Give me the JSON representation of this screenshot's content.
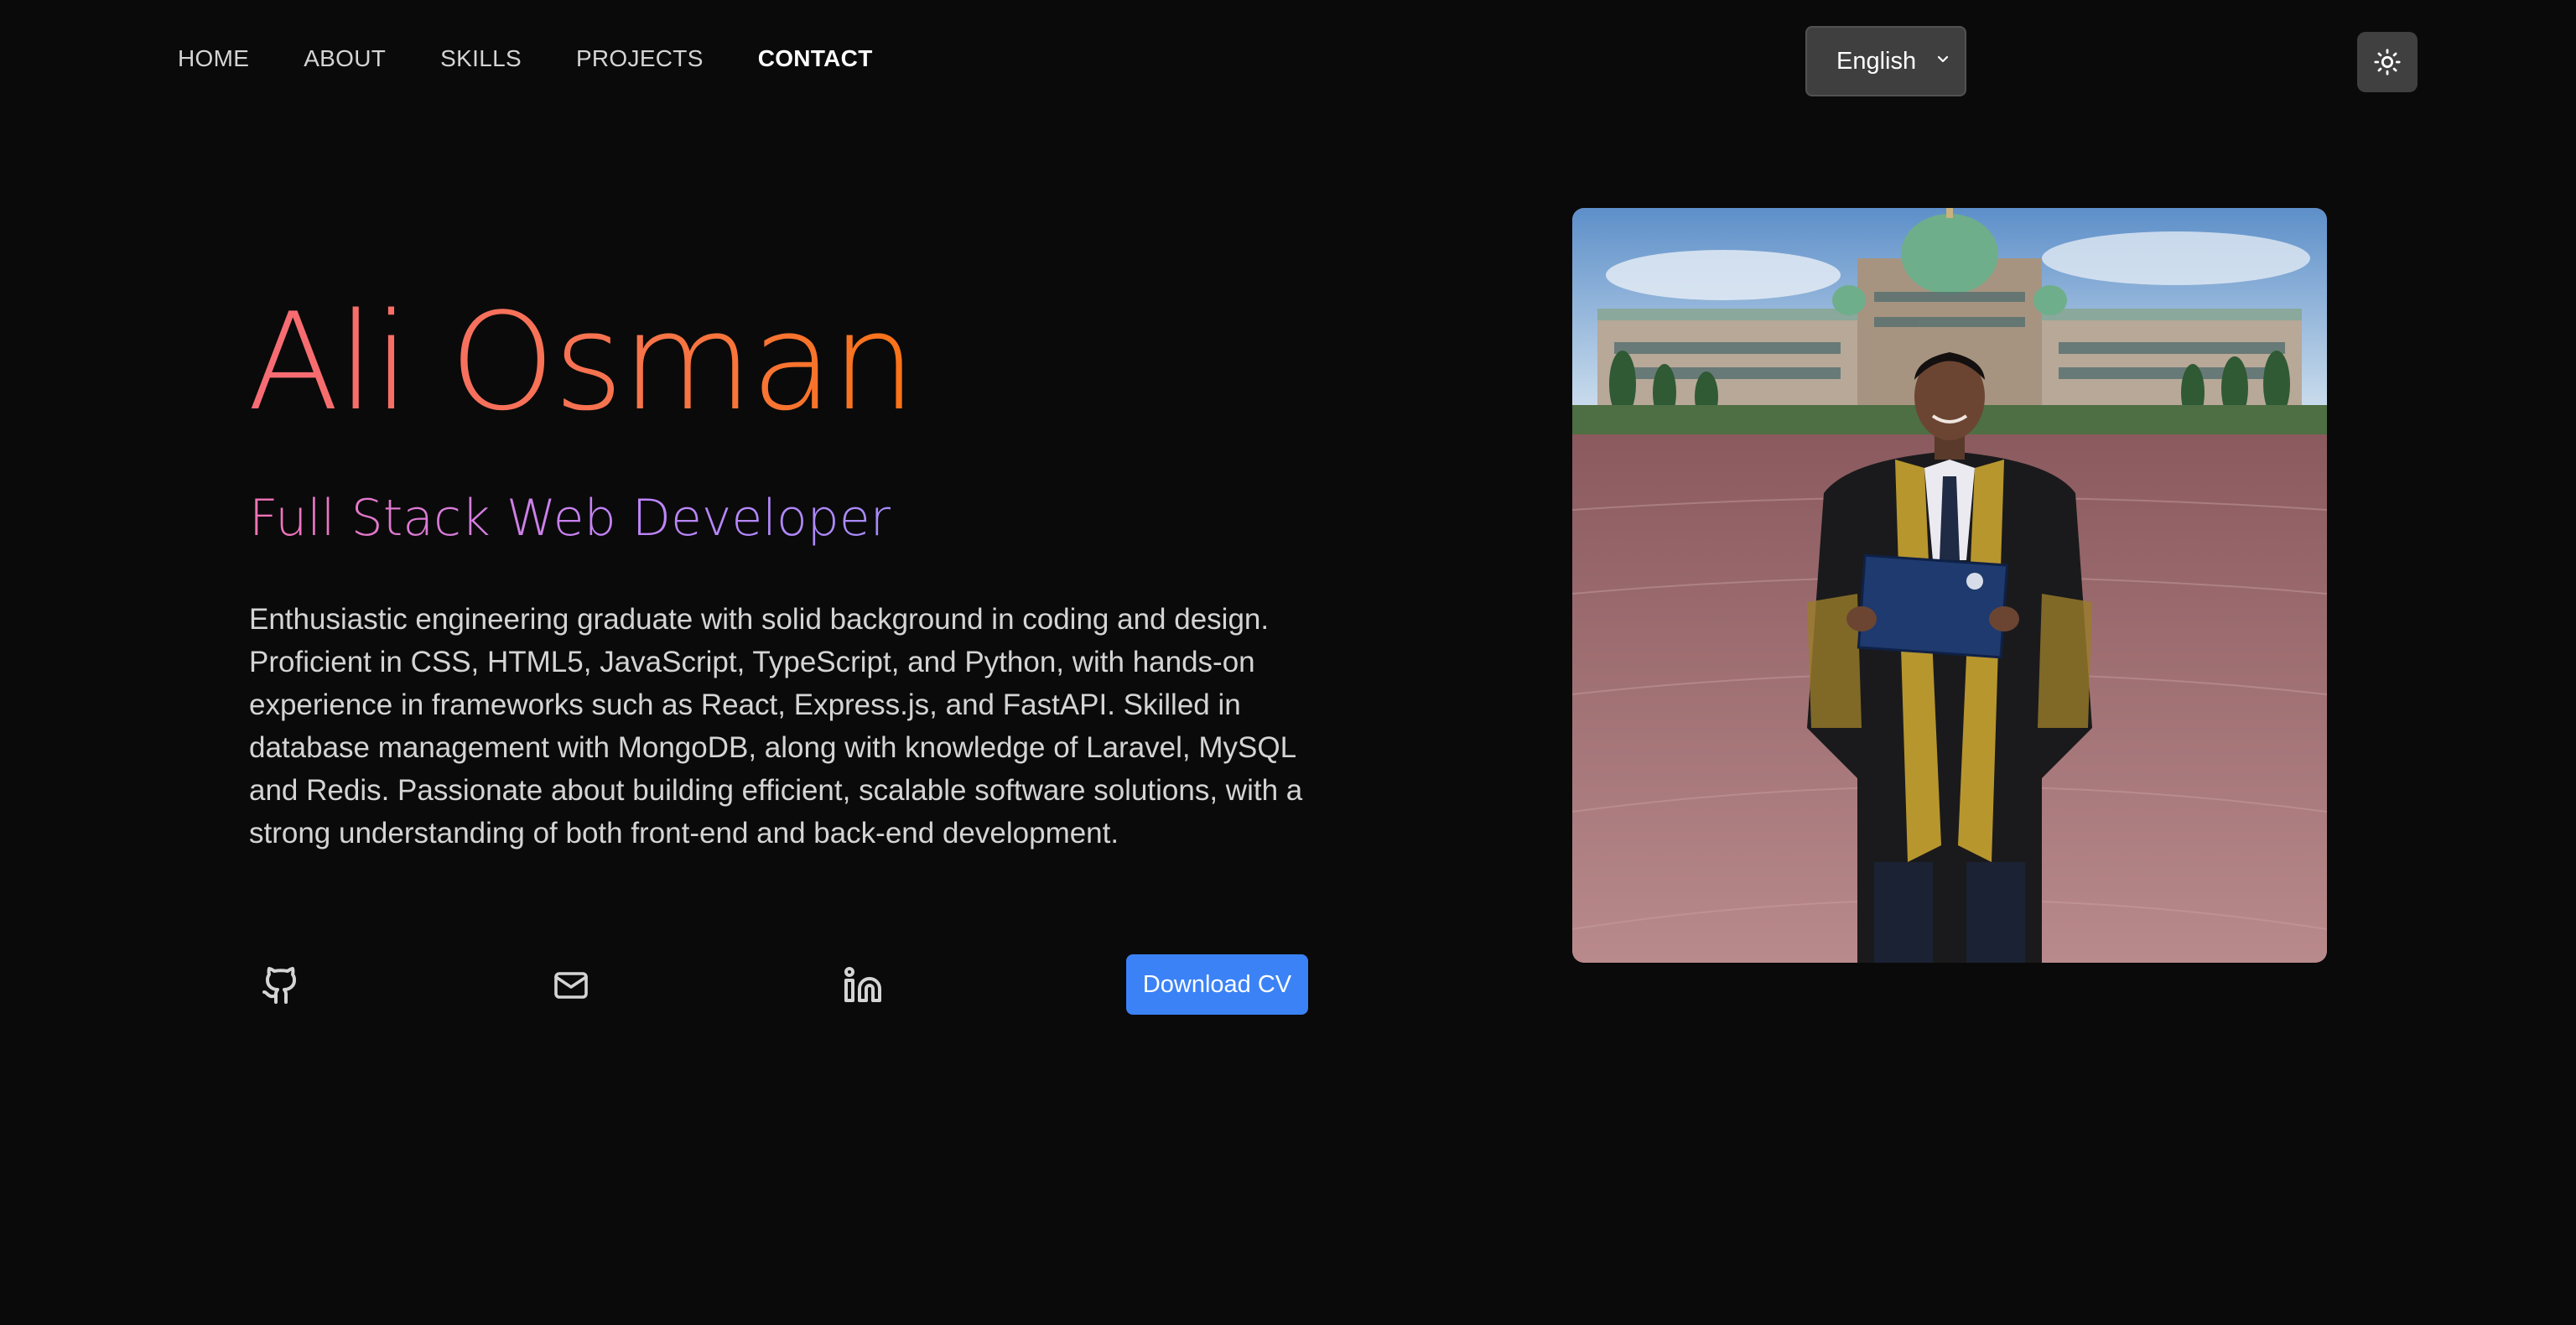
{
  "nav": {
    "links": [
      {
        "label": "HOME"
      },
      {
        "label": "ABOUT"
      },
      {
        "label": "SKILLS"
      },
      {
        "label": "PROJECTS"
      },
      {
        "label": "CONTACT"
      }
    ],
    "language": {
      "selected": "English"
    },
    "theme_toggle": {
      "icon": "sun-icon"
    }
  },
  "hero": {
    "name": "Ali Osman",
    "role": "Full Stack Web Developer",
    "bio": "Enthusiastic engineering graduate with solid background in coding and design. Proficient in CSS, HTML5, JavaScript, TypeScript, and Python, with hands-on experience in frameworks such as React, Express.js, and FastAPI. Skilled in database management with MongoDB, along with knowledge of Laravel, MySQL and Redis. Passionate about building efficient, scalable software solutions, with a strong understanding of both front-end and back-end development.",
    "socials": [
      {
        "icon": "github-icon"
      },
      {
        "icon": "mail-icon"
      },
      {
        "icon": "linkedin-icon"
      }
    ],
    "cv_button": "Download CV"
  },
  "colors": {
    "background": "#0a0a0a",
    "accent_blue": "#3b82f6",
    "name_gradient_start": "#f76b76",
    "name_gradient_end": "#f97316",
    "role_gradient_start": "#f472b6",
    "role_gradient_end": "#a78bfa"
  }
}
